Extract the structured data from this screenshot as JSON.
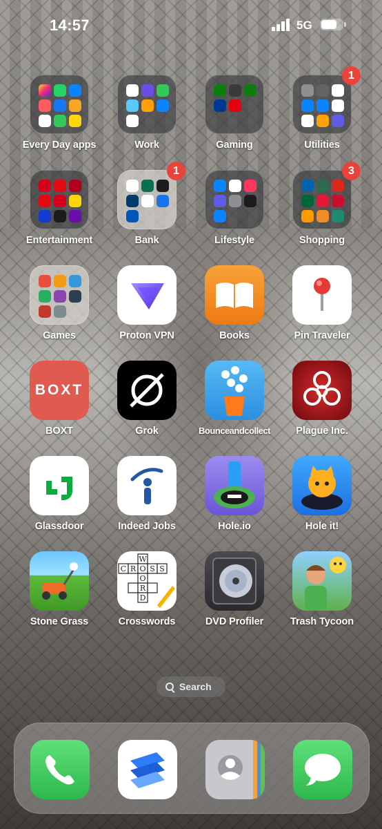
{
  "status": {
    "time": "14:57",
    "network": "5G"
  },
  "apps": [
    {
      "label": "Every Day apps",
      "type": "folder"
    },
    {
      "label": "Work",
      "type": "folder"
    },
    {
      "label": "Gaming",
      "type": "folder"
    },
    {
      "label": "Utilities",
      "type": "folder",
      "badge": "1"
    },
    {
      "label": "Entertainment",
      "type": "folder"
    },
    {
      "label": "Bank",
      "type": "folder",
      "badge": "1"
    },
    {
      "label": "Lifestyle",
      "type": "folder"
    },
    {
      "label": "Shopping",
      "type": "folder",
      "badge": "3"
    },
    {
      "label": "Games",
      "type": "folder"
    },
    {
      "label": "Proton VPN",
      "type": "app"
    },
    {
      "label": "Books",
      "type": "app"
    },
    {
      "label": "Pin Traveler",
      "type": "app"
    },
    {
      "label": "BOXT",
      "type": "app",
      "icon_text": "BOXT"
    },
    {
      "label": "Grok",
      "type": "app"
    },
    {
      "label": "Bounceandcollect",
      "type": "app"
    },
    {
      "label": "Plague Inc.",
      "type": "app"
    },
    {
      "label": "Glassdoor",
      "type": "app"
    },
    {
      "label": "Indeed Jobs",
      "type": "app"
    },
    {
      "label": "Hole.io",
      "type": "app"
    },
    {
      "label": "Hole it!",
      "type": "app"
    },
    {
      "label": "Stone Grass",
      "type": "app"
    },
    {
      "label": "Crosswords",
      "type": "app",
      "icon_letters": [
        "W",
        "C",
        "R",
        "O",
        "S",
        "S",
        "O",
        "R",
        "D"
      ]
    },
    {
      "label": "DVD Profiler",
      "type": "app"
    },
    {
      "label": "Trash Tycoon",
      "type": "app"
    }
  ],
  "search": {
    "label": "Search"
  },
  "dock": [
    {
      "name": "Phone"
    },
    {
      "name": "Spark Mail"
    },
    {
      "name": "Contacts"
    },
    {
      "name": "Messages"
    }
  ],
  "colors": {
    "badge": "#e8443b",
    "books": "#f08a24",
    "boxt": "#e05a4f",
    "plague": "#a3141c",
    "glassdoor": "#0caa41",
    "indeed": "#2557a7",
    "phone": "#35c759",
    "messages": "#34c759"
  }
}
